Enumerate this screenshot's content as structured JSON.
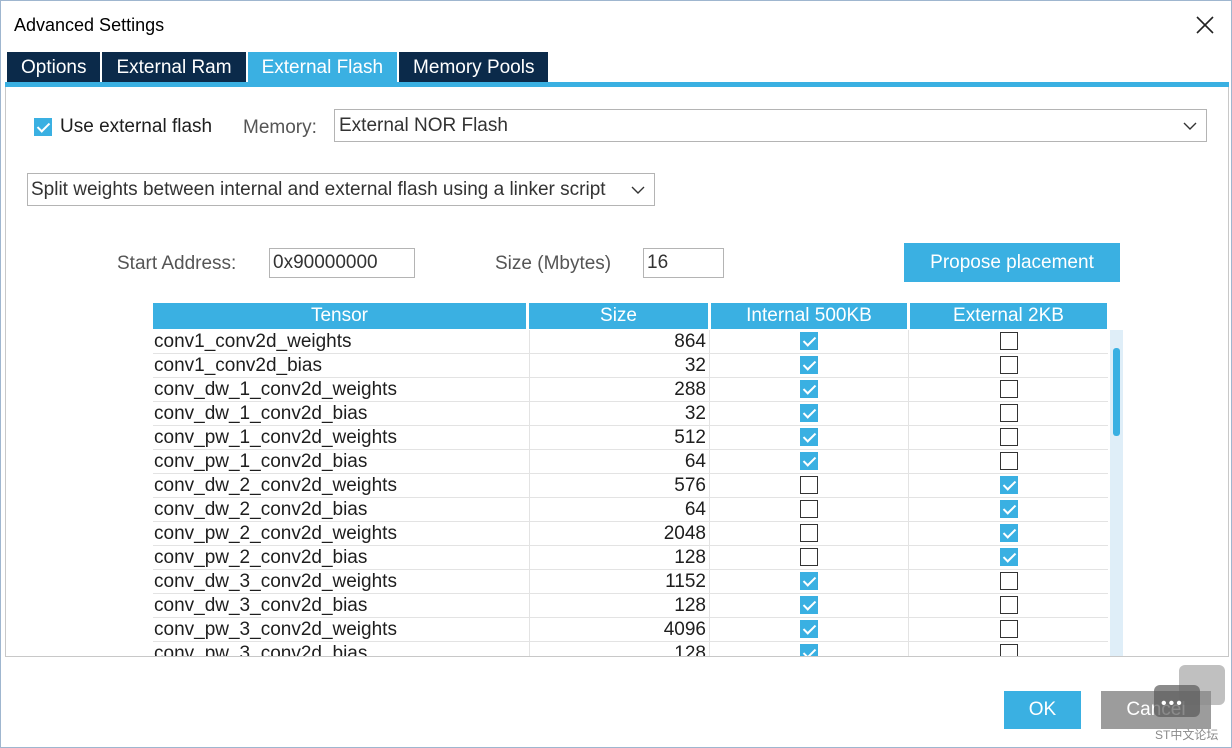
{
  "window": {
    "title": "Advanced Settings"
  },
  "tabs": [
    {
      "label": "Options",
      "active": false
    },
    {
      "label": "External Ram",
      "active": false
    },
    {
      "label": "External Flash",
      "active": true
    },
    {
      "label": "Memory Pools",
      "active": false
    }
  ],
  "use_external_flash": {
    "label": "Use external flash",
    "checked": true
  },
  "memory": {
    "label": "Memory:",
    "value": "External NOR Flash"
  },
  "split_mode": {
    "value": "Split weights between internal and external flash using a linker script"
  },
  "start_address": {
    "label": "Start Address:",
    "value": "0x90000000"
  },
  "size_mbytes": {
    "label": "Size (Mbytes)",
    "value": "16"
  },
  "propose_button": {
    "label": "Propose placement"
  },
  "table": {
    "headers": [
      "Tensor",
      "Size",
      "Internal 500KB",
      "External 2KB"
    ],
    "rows": [
      {
        "tensor": "conv1_conv2d_weights",
        "size": "864",
        "internal": true,
        "external": false
      },
      {
        "tensor": "conv1_conv2d_bias",
        "size": "32",
        "internal": true,
        "external": false
      },
      {
        "tensor": "conv_dw_1_conv2d_weights",
        "size": "288",
        "internal": true,
        "external": false
      },
      {
        "tensor": "conv_dw_1_conv2d_bias",
        "size": "32",
        "internal": true,
        "external": false
      },
      {
        "tensor": "conv_pw_1_conv2d_weights",
        "size": "512",
        "internal": true,
        "external": false
      },
      {
        "tensor": "conv_pw_1_conv2d_bias",
        "size": "64",
        "internal": true,
        "external": false
      },
      {
        "tensor": "conv_dw_2_conv2d_weights",
        "size": "576",
        "internal": false,
        "external": true
      },
      {
        "tensor": "conv_dw_2_conv2d_bias",
        "size": "64",
        "internal": false,
        "external": true
      },
      {
        "tensor": "conv_pw_2_conv2d_weights",
        "size": "2048",
        "internal": false,
        "external": true
      },
      {
        "tensor": "conv_pw_2_conv2d_bias",
        "size": "128",
        "internal": false,
        "external": true
      },
      {
        "tensor": "conv_dw_3_conv2d_weights",
        "size": "1152",
        "internal": true,
        "external": false
      },
      {
        "tensor": "conv_dw_3_conv2d_bias",
        "size": "128",
        "internal": true,
        "external": false
      },
      {
        "tensor": "conv_pw_3_conv2d_weights",
        "size": "4096",
        "internal": true,
        "external": false
      },
      {
        "tensor": "conv_pw_3_conv2d_bias",
        "size": "128",
        "internal": true,
        "external": false
      }
    ]
  },
  "footer": {
    "ok_label": "OK",
    "cancel_label": "Cancel"
  },
  "watermark": {
    "text": "ST中文论坛"
  },
  "colors": {
    "accent": "#3ab0e2",
    "tab_dark": "#0b2a4a",
    "cancel_gray": "#9c9c9c"
  }
}
